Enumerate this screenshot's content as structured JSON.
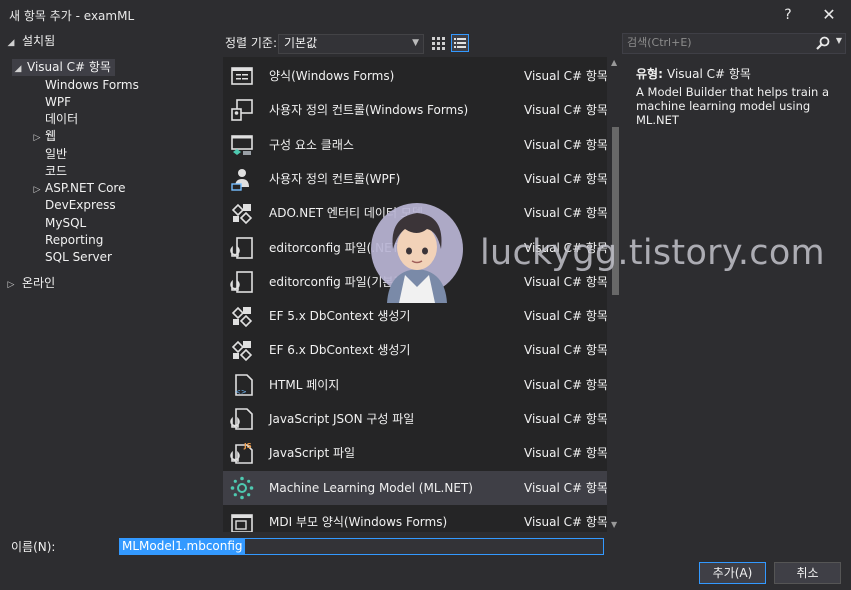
{
  "window": {
    "title": "새 항목 추가 - examML",
    "help_glyph": "?",
    "close_glyph": "✕"
  },
  "sidebar": {
    "installed": "설치됨",
    "visual_csharp": "Visual C# 항목",
    "children": [
      "Windows Forms",
      "WPF",
      "데이터",
      "웹",
      "일반",
      "코드",
      "ASP.NET Core",
      "DevExpress",
      "MySQL",
      "Reporting",
      "SQL Server"
    ],
    "online": "온라인"
  },
  "toolbar": {
    "sort_label": "정렬 기준:",
    "sort_value": "기본값"
  },
  "search": {
    "placeholder": "검색(Ctrl+E)",
    "icon": "search-icon"
  },
  "templates": [
    {
      "name": "양식(Windows Forms)",
      "category": "Visual C# 항목",
      "icon": "form-icon"
    },
    {
      "name": "사용자 정의 컨트롤(Windows Forms)",
      "category": "Visual C# 항목",
      "icon": "user-control-icon"
    },
    {
      "name": "구성 요소 클래스",
      "category": "Visual C# 항목",
      "icon": "component-class-icon"
    },
    {
      "name": "사용자 정의 컨트롤(WPF)",
      "category": "Visual C# 항목",
      "icon": "user-icon"
    },
    {
      "name": "ADO.NET 엔터티 데이터 모델",
      "category": "Visual C# 항목",
      "icon": "entity-model-icon"
    },
    {
      "name": "editorconfig 파일(.NET)",
      "category": "Visual C# 항목",
      "icon": "editorconfig-icon"
    },
    {
      "name": "editorconfig 파일(기본값)",
      "category": "Visual C# 항목",
      "icon": "editorconfig-icon"
    },
    {
      "name": "EF 5.x DbContext 생성기",
      "category": "Visual C# 항목",
      "icon": "dbcontext-icon"
    },
    {
      "name": "EF 6.x DbContext 생성기",
      "category": "Visual C# 항목",
      "icon": "dbcontext-icon"
    },
    {
      "name": "HTML 페이지",
      "category": "Visual C# 항목",
      "icon": "html-page-icon"
    },
    {
      "name": "JavaScript JSON 구성 파일",
      "category": "Visual C# 항목",
      "icon": "json-file-icon"
    },
    {
      "name": "JavaScript 파일",
      "category": "Visual C# 항목",
      "icon": "js-file-icon"
    },
    {
      "name": "Machine Learning Model (ML.NET)",
      "category": "Visual C# 항목",
      "icon": "ml-model-icon"
    },
    {
      "name": "MDI 부모 양식(Windows Forms)",
      "category": "Visual C# 항목",
      "icon": "mdi-form-icon"
    }
  ],
  "selected_index": 12,
  "details": {
    "type_label": "유형:",
    "type_value": "Visual C# 항목",
    "description": "A Model Builder that helps train a machine learning model using ML.NET"
  },
  "watermark": "luckygg.tistory.com",
  "bottom": {
    "name_label": "이름(N):",
    "name_value": "MLModel1.mbconfig",
    "add_label": "추가(A)",
    "cancel_label": "취소"
  },
  "colors": {
    "background": "#2d2d30",
    "list_background": "#252526",
    "selection": "#3f3f46",
    "accent": "#3399ff",
    "icon_teal": "#4ec9b0"
  }
}
